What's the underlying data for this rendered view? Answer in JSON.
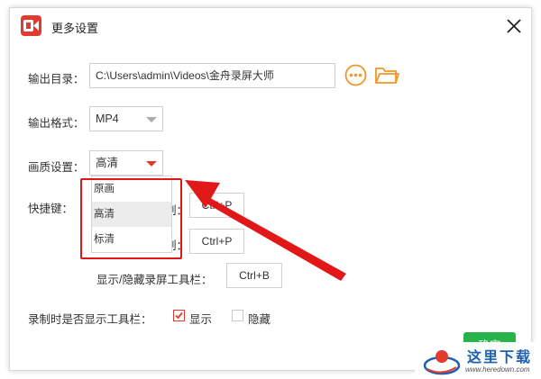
{
  "window": {
    "title": "更多设置"
  },
  "output_dir": {
    "label": "输出目录：",
    "value": "C:\\Users\\admin\\Videos\\金舟录屏大师"
  },
  "output_format": {
    "label": "输出格式：",
    "value": "MP4"
  },
  "quality": {
    "label": "画质设置：",
    "value": "高清",
    "options": [
      "原画",
      "高清",
      "标清"
    ],
    "selected_index": 1
  },
  "hotkeys": {
    "label": "快捷键：",
    "row1": {
      "label_partial": "制：",
      "value": "Ctrl+P"
    },
    "row2": {
      "label_partial": "制：",
      "value": "Ctrl+P"
    },
    "row3": {
      "label": "显示/隐藏录屏工具栏：",
      "value": "Ctrl+B"
    }
  },
  "toolbar_visibility": {
    "label": "录制时是否显示工具栏：",
    "show_label": "显示",
    "show_checked": true,
    "hide_label": "隐藏",
    "hide_checked": false
  },
  "ok_button": {
    "label": "确定"
  },
  "watermark": {
    "text_cn": "这里下载",
    "url": "www.heredown.com"
  },
  "colors": {
    "accent": "#e23b2e",
    "annotation": "#e01818",
    "ok_button": "#27b24a",
    "folder_icon": "#f0952a"
  }
}
